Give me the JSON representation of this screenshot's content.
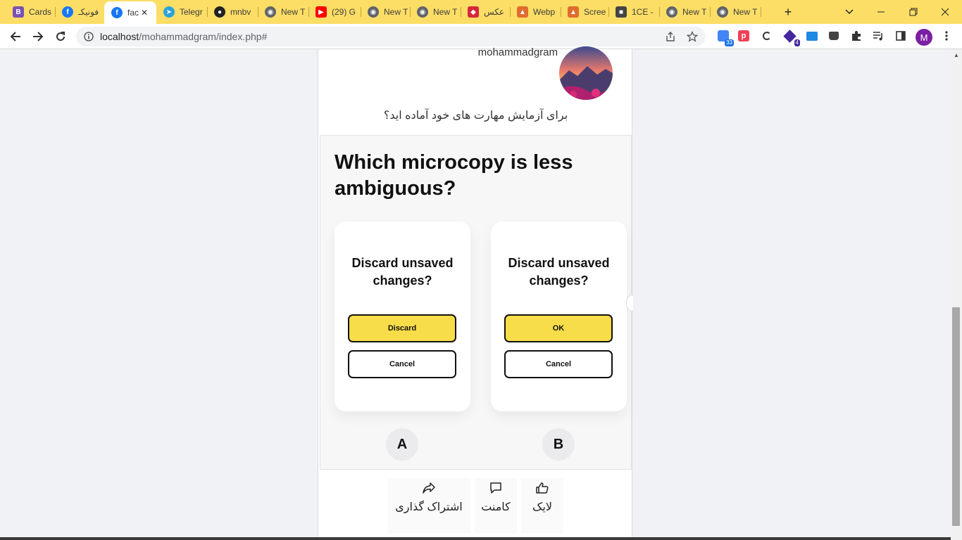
{
  "browser": {
    "tabs": [
      {
        "title": "Cards",
        "icon": "bootstrap-icon",
        "color": "#7952b3",
        "glyph": "B"
      },
      {
        "title": "فونیکـ",
        "icon": "facebook-icon",
        "color": "#1877f2",
        "glyph": "f"
      },
      {
        "title": "fac",
        "icon": "facebook-icon",
        "color": "#1877f2",
        "glyph": "f",
        "active": true
      },
      {
        "title": "Telegr",
        "icon": "telegram-icon",
        "color": "#2aa3dc",
        "glyph": "➤"
      },
      {
        "title": "mnbv",
        "icon": "github-icon",
        "color": "#222222",
        "glyph": "●"
      },
      {
        "title": "New T",
        "icon": "chrome-icon",
        "color": "#606368",
        "glyph": "◉"
      },
      {
        "title": "(29) G",
        "icon": "youtube-icon",
        "color": "#ff0000",
        "glyph": "▶"
      },
      {
        "title": "New T",
        "icon": "chrome-icon",
        "color": "#606368",
        "glyph": "◉"
      },
      {
        "title": "New T",
        "icon": "chrome-icon",
        "color": "#606368",
        "glyph": "◉"
      },
      {
        "title": "عکس",
        "icon": "photo-app-icon",
        "color": "#d6283b",
        "glyph": "◆"
      },
      {
        "title": "Webp",
        "icon": "image-icon",
        "color": "#e06c2e",
        "glyph": "▲"
      },
      {
        "title": "Scree",
        "icon": "image-icon",
        "color": "#e06c2e",
        "glyph": "▲"
      },
      {
        "title": "1CE -",
        "icon": "store-icon",
        "color": "#444444",
        "glyph": "■"
      },
      {
        "title": "New T",
        "icon": "chrome-icon",
        "color": "#606368",
        "glyph": "◉"
      },
      {
        "title": "New T",
        "icon": "chrome-icon",
        "color": "#606368",
        "glyph": "◉"
      }
    ],
    "new_tab_symbol": "+",
    "address": {
      "host": "localhost",
      "path": "/mohammadgram/index.php#"
    },
    "extension_badges": {
      "first": "33",
      "fourth": "4"
    },
    "profile_initial": "M",
    "accent_color": "#fcde66"
  },
  "post": {
    "username": "mohammadgram",
    "caption": "برای آزمایش مهارت های خود آماده اید؟",
    "quiz": {
      "question": "Which microcopy is less ambiguous?",
      "options": [
        {
          "letter": "A",
          "title": "Discard unsaved changes?",
          "primary": "Discard",
          "secondary": "Cancel"
        },
        {
          "letter": "B",
          "title": "Discard unsaved changes?",
          "primary": "OK",
          "secondary": "Cancel"
        }
      ],
      "primary_color": "#f8dd4a"
    },
    "actions": {
      "share": "اشتراک گذاری",
      "comment": "کامنت",
      "like": "لایک"
    }
  }
}
